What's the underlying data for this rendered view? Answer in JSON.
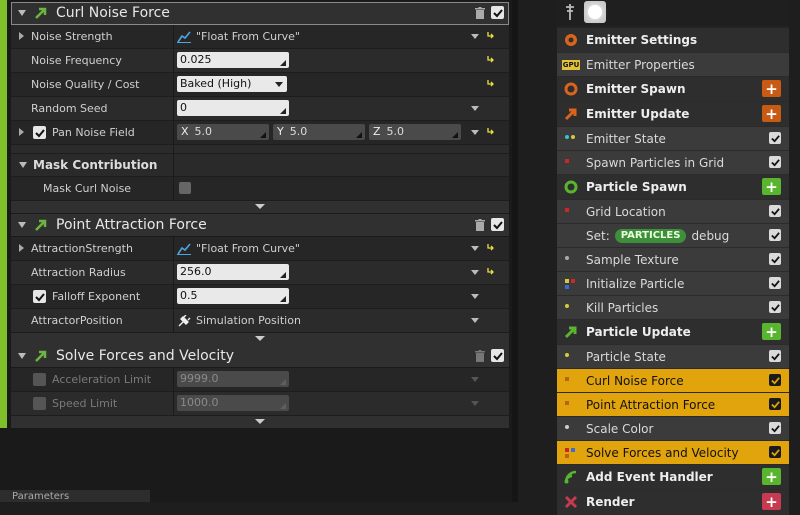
{
  "curl_panel": {
    "title": "Curl Noise Force",
    "noise_strength": {
      "label": "Noise Strength",
      "value": "\"Float From Curve\""
    },
    "noise_frequency": {
      "label": "Noise Frequency",
      "value": "0.025"
    },
    "noise_quality": {
      "label": "Noise Quality / Cost",
      "value": "Baked (High)"
    },
    "random_seed": {
      "label": "Random Seed",
      "value": "0"
    },
    "pan_noise": {
      "label": "Pan Noise Field",
      "x_label": "X",
      "x": "5.0",
      "y_label": "Y",
      "y": "5.0",
      "z_label": "Z",
      "z": "5.0"
    },
    "mask_section": "Mask Contribution",
    "mask_curl": {
      "label": "Mask Curl Noise"
    }
  },
  "point_panel": {
    "title": "Point Attraction Force",
    "attraction_strength": {
      "label": "AttractionStrength",
      "value": "\"Float From Curve\""
    },
    "attraction_radius": {
      "label": "Attraction Radius",
      "value": "256.0"
    },
    "falloff": {
      "label": "Falloff Exponent",
      "value": "0.5"
    },
    "position": {
      "label": "AttractorPosition",
      "value": "Simulation Position"
    }
  },
  "solve_panel": {
    "title": "Solve Forces and Velocity",
    "accel": {
      "label": "Acceleration Limit",
      "value": "9999.0"
    },
    "speed": {
      "label": "Speed Limit",
      "value": "1000.0"
    }
  },
  "bottom_tab": "Parameters",
  "stack": {
    "emitter_settings": "Emitter Settings",
    "emitter_properties": "Emitter Properties",
    "gpu_badge": "GPU",
    "emitter_spawn": "Emitter Spawn",
    "emitter_update": "Emitter Update",
    "emitter_state": "Emitter State",
    "spawn_grid": "Spawn Particles in Grid",
    "particle_spawn": "Particle Spawn",
    "grid_location": "Grid Location",
    "set_label": "Set:",
    "set_pill": "PARTICLES",
    "set_value": "debug",
    "sample_texture": "Sample Texture",
    "init_particle": "Initialize Particle",
    "kill_particles": "Kill Particles",
    "particle_update": "Particle Update",
    "particle_state": "Particle State",
    "curl_noise": "Curl Noise Force",
    "point_attraction": "Point Attraction Force",
    "scale_color": "Scale Color",
    "solve_forces": "Solve Forces and Velocity",
    "add_event": "Add Event Handler",
    "render": "Render",
    "plus": "+"
  },
  "colors": {
    "accent_orange": "#e2a40c",
    "green_plus": "#58b52d",
    "orange_plus": "#c85a14",
    "stage_green": "#7fbf2a"
  }
}
